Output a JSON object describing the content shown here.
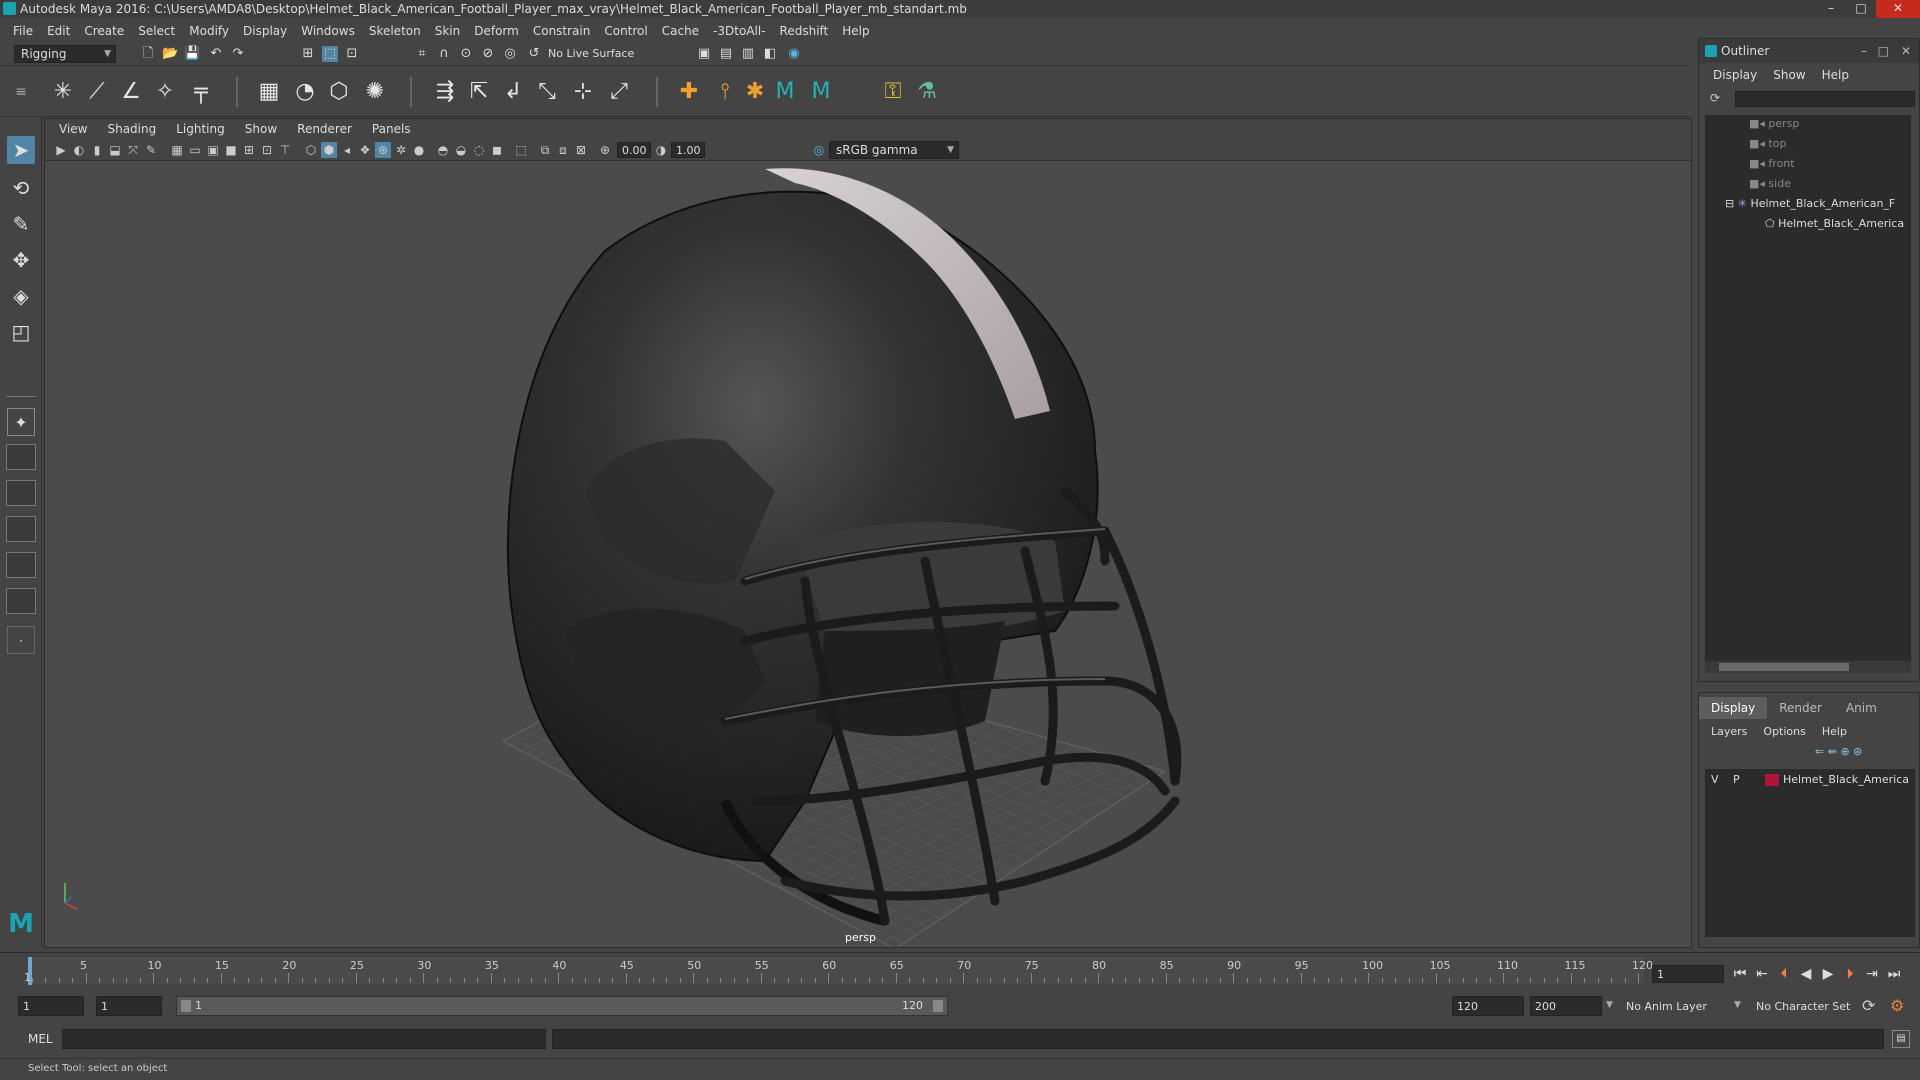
{
  "window": {
    "title": "Autodesk Maya 2016: C:\\Users\\AMDA8\\Desktop\\Helmet_Black_American_Football_Player_max_vray\\Helmet_Black_American_Football_Player_mb_standart.mb",
    "controls": [
      "–",
      "□",
      "✕"
    ]
  },
  "menubar": [
    "File",
    "Edit",
    "Create",
    "Select",
    "Modify",
    "Display",
    "Windows",
    "Skeleton",
    "Skin",
    "Deform",
    "Constrain",
    "Control",
    "Cache",
    "-3DtoAll-",
    "Redshift",
    "Help"
  ],
  "statusline": {
    "mode": "Rigging",
    "live_surface": "No Live Surface"
  },
  "viewport": {
    "menu": [
      "View",
      "Shading",
      "Lighting",
      "Show",
      "Renderer",
      "Panels"
    ],
    "exposure": "0.00",
    "gamma": "1.00",
    "color_space": "sRGB gamma",
    "camera": "persp"
  },
  "outliner": {
    "title": "Outliner",
    "menu": [
      "Display",
      "Show",
      "Help"
    ],
    "items": [
      {
        "label": "persp",
        "kind": "camera"
      },
      {
        "label": "top",
        "kind": "camera"
      },
      {
        "label": "front",
        "kind": "camera"
      },
      {
        "label": "side",
        "kind": "camera"
      },
      {
        "label": "Helmet_Black_American_F",
        "kind": "group"
      },
      {
        "label": "Helmet_Black_America",
        "kind": "mesh"
      }
    ]
  },
  "layer_editor": {
    "tabs": [
      "Display",
      "Render",
      "Anim"
    ],
    "active_tab": "Display",
    "menu": [
      "Layers",
      "Options",
      "Help"
    ],
    "layers": [
      {
        "v": "V",
        "p": "P",
        "name": "Helmet_Black_America",
        "color": "#b0143a"
      }
    ]
  },
  "timeline": {
    "ticks": [
      "5",
      "10",
      "15",
      "20",
      "25",
      "30",
      "35",
      "40",
      "45",
      "50",
      "55",
      "60",
      "65",
      "70",
      "75",
      "80",
      "85",
      "90",
      "95",
      "100",
      "105",
      "110",
      "115",
      "120"
    ],
    "current_start": "1",
    "current_frame": "1"
  },
  "range": {
    "start": "1",
    "anim_start": "1",
    "slider_start": "1",
    "slider_end": "120",
    "end": "120",
    "anim_end": "200",
    "anim_layer": "No Anim Layer",
    "character_set": "No Character Set"
  },
  "cmdline": {
    "label": "MEL",
    "help": "Select Tool: select an object"
  },
  "colors": {
    "accent": "#5285a6",
    "layer": "#b0143a",
    "helmet": "#2a2a2a",
    "stripe": "#c9c2c3"
  }
}
